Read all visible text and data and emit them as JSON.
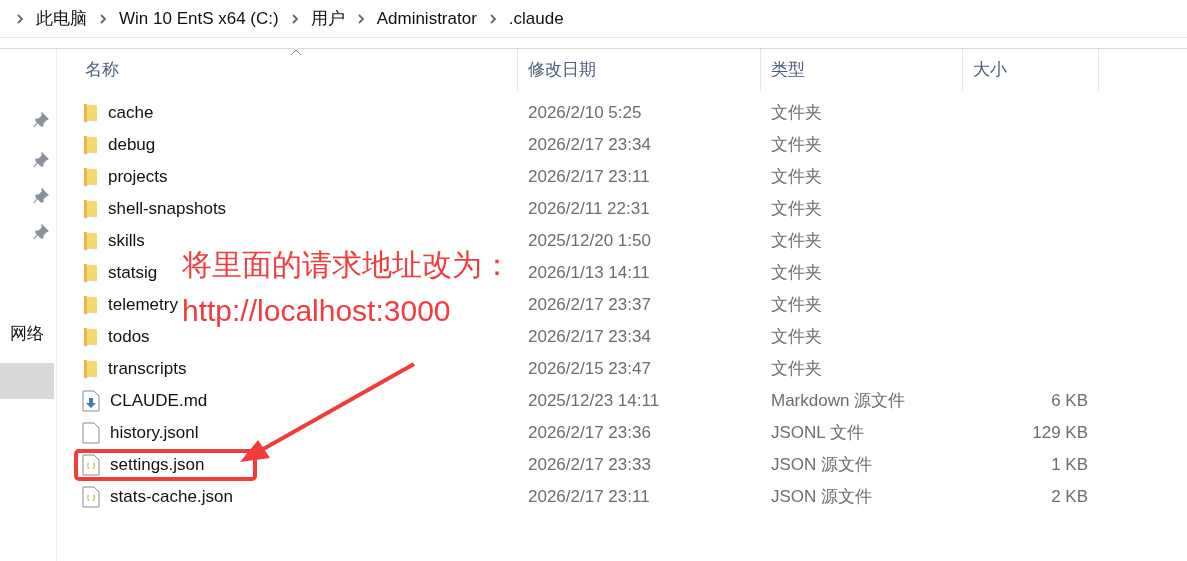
{
  "breadcrumb": [
    "此电脑",
    "Win 10 EntS x64 (C:)",
    "用户",
    "Administrator",
    ".claude"
  ],
  "nav_pane": {
    "partial_label": "网络"
  },
  "columns": [
    "名称",
    "修改日期",
    "类型",
    "大小"
  ],
  "files": [
    {
      "kind": "folder",
      "name": "cache",
      "date": "2026/2/10 5:25",
      "type": "文件夹",
      "highlighted": false
    },
    {
      "kind": "folder",
      "name": "debug",
      "date": "2026/2/17 23:34",
      "type": "文件夹",
      "highlighted": false
    },
    {
      "kind": "folder",
      "name": "projects",
      "date": "2026/2/17 23:11",
      "type": "文件夹",
      "highlighted": false
    },
    {
      "kind": "folder",
      "name": "shell-snapshots",
      "date": "2026/2/11 22:31",
      "type": "文件夹",
      "highlighted": false
    },
    {
      "kind": "folder",
      "name": "skills",
      "date": "2025/12/20 1:50",
      "type": "文件夹",
      "highlighted": false
    },
    {
      "kind": "folder",
      "name": "statsig",
      "date": "2026/1/13 14:11",
      "type": "文件夹",
      "highlighted": false
    },
    {
      "kind": "folder",
      "name": "telemetry",
      "date": "2026/2/17 23:37",
      "type": "文件夹",
      "highlighted": false
    },
    {
      "kind": "folder",
      "name": "todos",
      "date": "2026/2/17 23:34",
      "type": "文件夹",
      "highlighted": false
    },
    {
      "kind": "folder",
      "name": "transcripts",
      "date": "2026/2/15 23:47",
      "type": "文件夹",
      "highlighted": false
    },
    {
      "kind": "markdown",
      "name": "CLAUDE.md",
      "date": "2025/12/23 14:11",
      "type": "Markdown 源文件",
      "size": "6 KB",
      "highlighted": false
    },
    {
      "kind": "file",
      "name": "history.jsonl",
      "date": "2026/2/17 23:36",
      "type": "JSONL 文件",
      "size": "129 KB",
      "highlighted": false
    },
    {
      "kind": "json",
      "name": "settings.json",
      "date": "2026/2/17 23:33",
      "type": "JSON 源文件",
      "size": "1 KB",
      "highlighted": true
    },
    {
      "kind": "json",
      "name": "stats-cache.json",
      "date": "2026/2/17 23:11",
      "type": "JSON 源文件",
      "size": "2 KB",
      "highlighted": false
    }
  ],
  "annotation": {
    "line_1": "将里面的请求地址改为：",
    "line_2": "http://localhost:3000"
  }
}
